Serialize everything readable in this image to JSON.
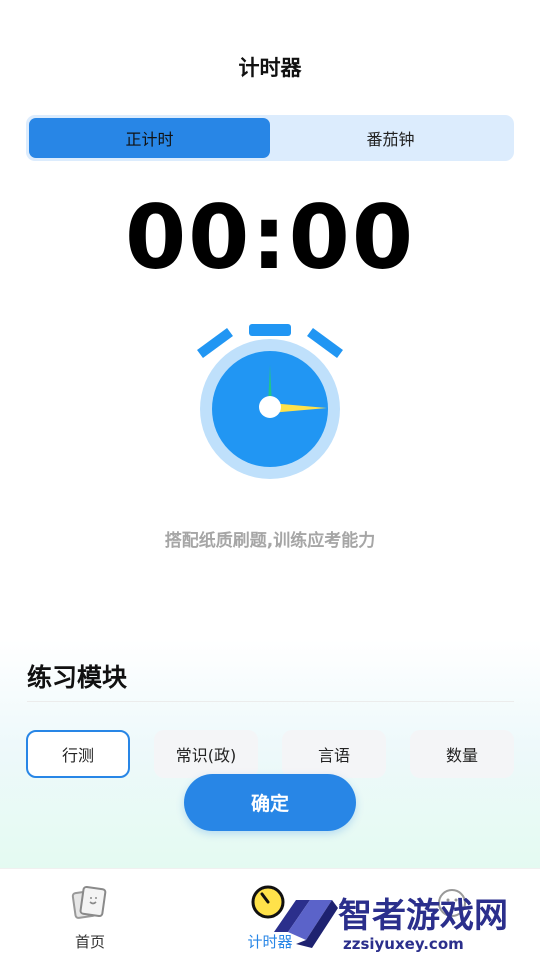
{
  "header": {
    "title": "计时器"
  },
  "mode_tabs": [
    {
      "label": "正计时",
      "active": true
    },
    {
      "label": "番茄钟",
      "active": false
    }
  ],
  "timer": {
    "display": "00:00"
  },
  "slogan": "搭配纸质刷题,训练应考能力",
  "practice": {
    "section_title": "练习模块",
    "modules": [
      {
        "label": "行测",
        "selected": true
      },
      {
        "label": "常识(政)",
        "selected": false
      },
      {
        "label": "言语",
        "selected": false
      },
      {
        "label": "数量",
        "selected": false
      }
    ]
  },
  "confirm_label": "确定",
  "bottom_nav": [
    {
      "label": "首页",
      "icon": "cards-icon",
      "active": false
    },
    {
      "label": "计时器",
      "icon": "stopwatch-icon",
      "active": true
    },
    {
      "label": "",
      "icon": "smiley-icon",
      "active": false
    }
  ],
  "watermark": {
    "brand": "智者游戏网",
    "url": "zzsiyuxey.com"
  },
  "colors": {
    "accent": "#2886e6",
    "segment_bg": "#dcecfd",
    "clock_outer": "#bfe0fb",
    "clock_face": "#2196f3",
    "hand_green": "#21c58b",
    "hand_yellow": "#ffe24a"
  }
}
